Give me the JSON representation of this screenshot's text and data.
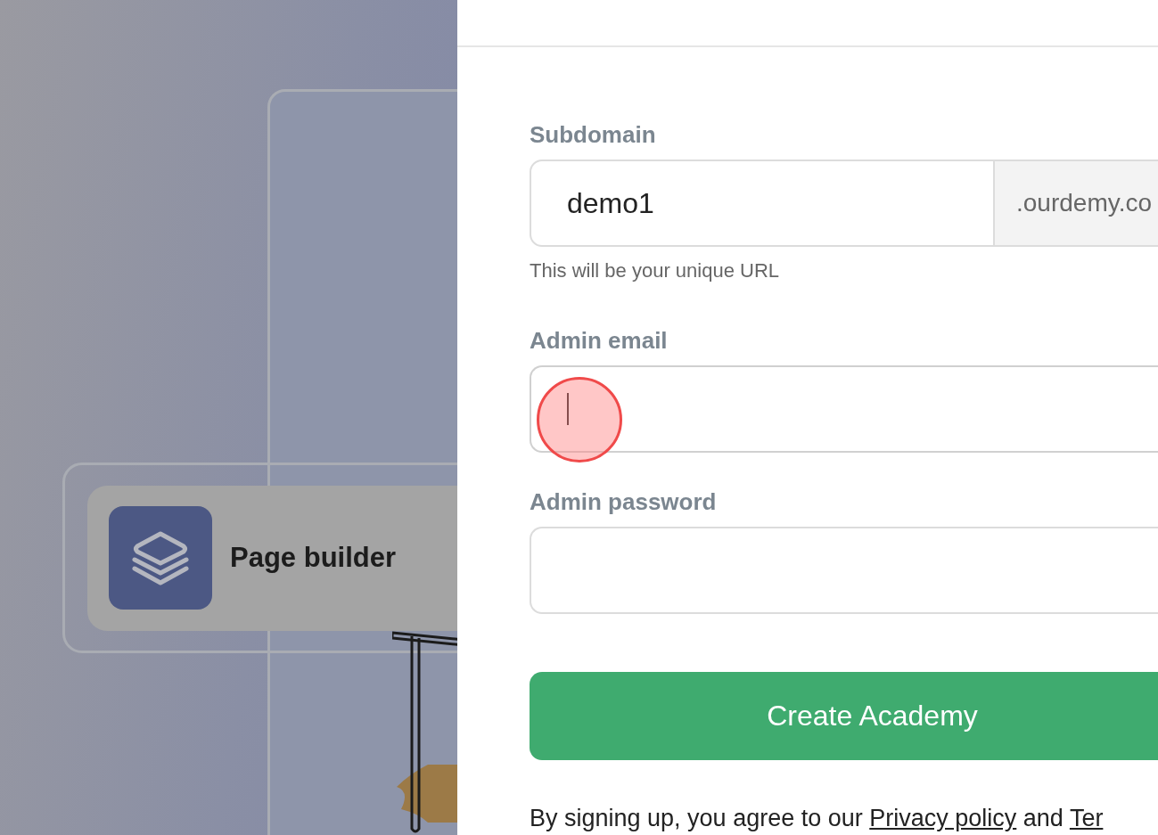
{
  "showcase": {
    "feature_label": "Page builder"
  },
  "form": {
    "fields": [
      {
        "kind": "suffix",
        "label": "Subdomain",
        "value": "demo1",
        "suffix": ".ourdemy.co",
        "help": "This will be your unique URL",
        "focused": false
      },
      {
        "kind": "plain",
        "label": "Admin email",
        "focused": true
      },
      {
        "kind": "plain",
        "label": "Admin password",
        "focused": false
      }
    ],
    "submit": "Create Academy",
    "terms": {
      "before": "By signing up, you agree to our",
      "privacy_link": "Privacy policy",
      "middle": "and",
      "terms_link": "Ter"
    }
  }
}
